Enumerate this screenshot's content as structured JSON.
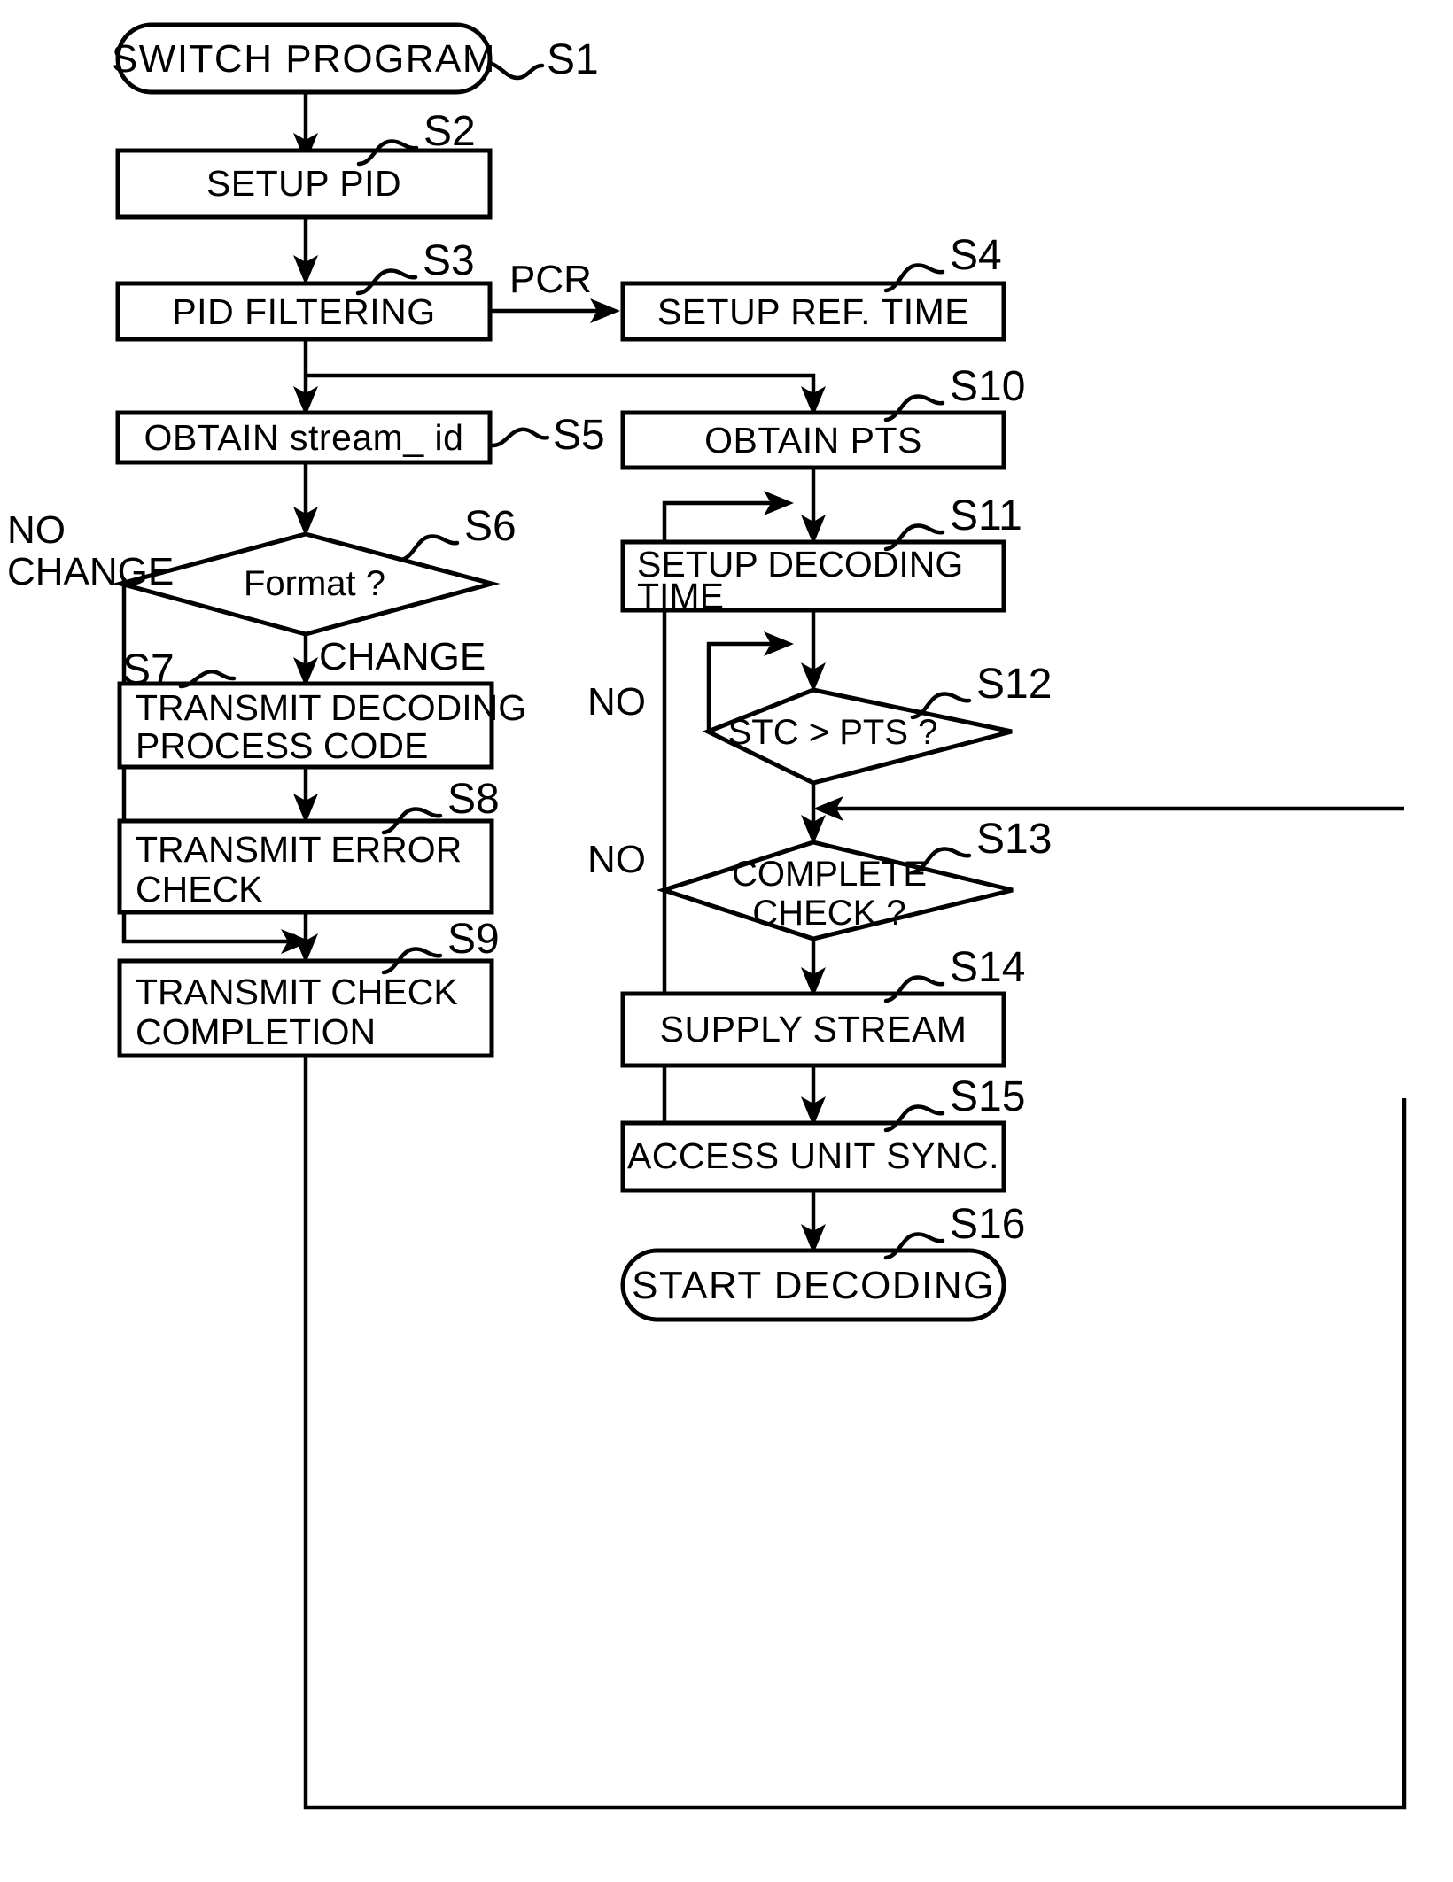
{
  "diagram": {
    "title": "MPEG program switching decode flowchart",
    "type": "flowchart",
    "background": "#ffffff",
    "ink": "#000000"
  },
  "nodes": {
    "s1": {
      "step": "S1",
      "label": "SWITCH  PROGRAM",
      "shape": "terminator"
    },
    "s2": {
      "step": "S2",
      "label": "SETUP  PID",
      "shape": "process"
    },
    "s3": {
      "step": "S3",
      "label": "PID  FILTERING",
      "shape": "process"
    },
    "s4": {
      "step": "S4",
      "label": "SETUP  REF.  TIME",
      "shape": "process"
    },
    "s5": {
      "step": "S5",
      "label": "OBTAIN  stream_ id",
      "shape": "process"
    },
    "s6": {
      "step": "S6",
      "label": "Format ?",
      "shape": "decision"
    },
    "s7": {
      "step": "S7",
      "label_line1": "TRANSMIT  DECODING",
      "label_line2": "PROCESS  CODE",
      "shape": "process"
    },
    "s8": {
      "step": "S8",
      "label_line1": "TRANSMIT  ERROR",
      "label_line2": "CHECK",
      "shape": "process"
    },
    "s9": {
      "step": "S9",
      "label_line1": "TRANSMIT  CHECK",
      "label_line2": "COMPLETION",
      "shape": "process"
    },
    "s10": {
      "step": "S10",
      "label": "OBTAIN  PTS",
      "shape": "process"
    },
    "s11": {
      "step": "S11",
      "label_line1": "SETUP  DECODING",
      "label_line2": "TIME",
      "shape": "process"
    },
    "s12": {
      "step": "S12",
      "label": "STC > PTS ?",
      "shape": "decision"
    },
    "s13": {
      "step": "S13",
      "label_line1": "COMPLETE",
      "label_line2": "CHECK ?",
      "shape": "decision"
    },
    "s14": {
      "step": "S14",
      "label": "SUPPLY  STREAM",
      "shape": "process"
    },
    "s15": {
      "step": "S15",
      "label": "ACCESS  UNIT  SYNC.",
      "shape": "process"
    },
    "s16": {
      "step": "S16",
      "label": "START  DECODING",
      "shape": "terminator"
    }
  },
  "edge_labels": {
    "pcr": "PCR",
    "no_change_line1": "NO",
    "no_change_line2": "CHANGE",
    "change": "CHANGE",
    "no_s12": "NO",
    "no_s13": "NO"
  },
  "step_labels": [
    "S1",
    "S2",
    "S3",
    "S4",
    "S5",
    "S6",
    "S7",
    "S8",
    "S9",
    "S10",
    "S11",
    "S12",
    "S13",
    "S14",
    "S15",
    "S16"
  ]
}
